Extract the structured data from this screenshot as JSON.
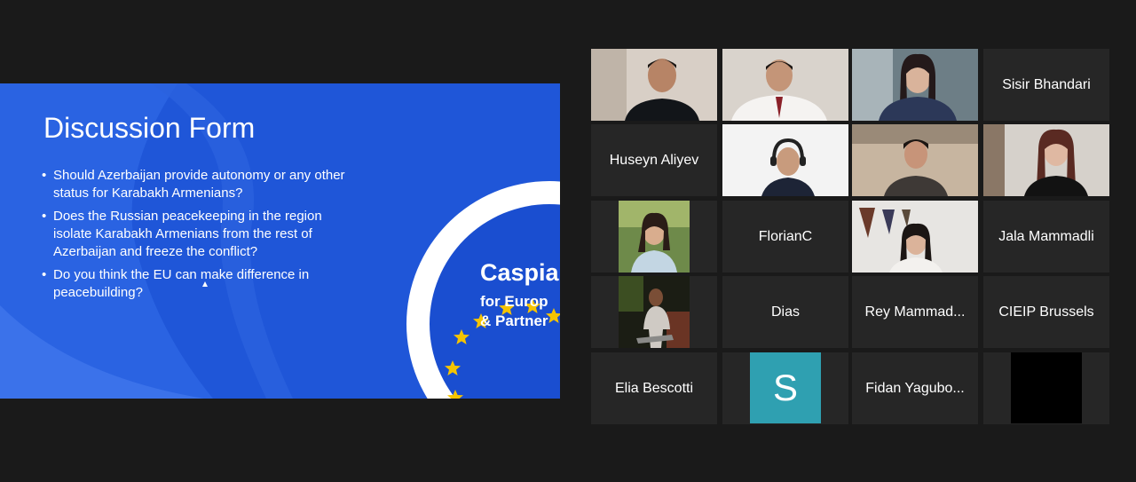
{
  "slide": {
    "title": "Discussion Form",
    "bullets": [
      "Should Azerbaijan provide autonomy or any other status for Karabakh Armenians?",
      "Does the Russian peacekeeping in the region isolate Karabakh Armenians from the rest of Azerbaijan and freeze the conflict?",
      "Do you think the EU can make difference in peacebuilding?"
    ],
    "logo": {
      "name": "Caspia",
      "line2": "for Europ",
      "line3": "& Partner"
    }
  },
  "participants": [
    {
      "name": "",
      "type": "video",
      "speaking": false
    },
    {
      "name": "",
      "type": "video",
      "speaking": false
    },
    {
      "name": "",
      "type": "video",
      "speaking": true
    },
    {
      "name": "Sisir Bhandari",
      "type": "name"
    },
    {
      "name": "Huseyn Aliyev",
      "type": "name"
    },
    {
      "name": "",
      "type": "video",
      "speaking": false
    },
    {
      "name": "",
      "type": "video",
      "speaking": false
    },
    {
      "name": "",
      "type": "video",
      "speaking": false
    },
    {
      "name": "",
      "type": "avatar-photo"
    },
    {
      "name": "FlorianC",
      "type": "name"
    },
    {
      "name": "",
      "type": "video",
      "speaking": false
    },
    {
      "name": "Jala Mammadli",
      "type": "name"
    },
    {
      "name": "",
      "type": "avatar-photo"
    },
    {
      "name": "Dias",
      "type": "name"
    },
    {
      "name": "Rey Mammad...",
      "type": "name"
    },
    {
      "name": "CIEIP Brussels",
      "type": "name"
    },
    {
      "name": "Elia Bescotti",
      "type": "name"
    },
    {
      "name": "",
      "type": "letter-avatar",
      "letter": "S"
    },
    {
      "name": "Fidan Yagubo...",
      "type": "name"
    },
    {
      "name": "",
      "type": "black-avatar"
    }
  ],
  "colors": {
    "background": "#1a1a1a",
    "tile": "#262626",
    "slide_blue": "#1f56d8",
    "speaking_border": "#a6d65a",
    "letter_avatar": "#2fa0b1",
    "eu_star": "#f5c400"
  }
}
